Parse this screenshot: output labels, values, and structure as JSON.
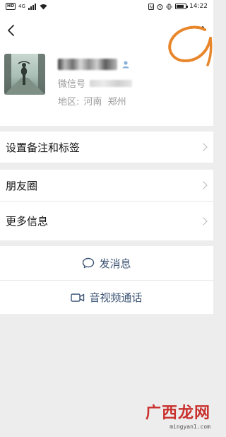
{
  "status_bar": {
    "hd_badge": "HD",
    "network_label": "4G",
    "battery_level": 0.8,
    "time": "14:22"
  },
  "header": {
    "back_icon": "chevron-left-icon",
    "more_icon": "ellipsis-icon"
  },
  "profile": {
    "wechat_id_label": "微信号",
    "region_label": "地区:",
    "region_value": "河南  郑州"
  },
  "menu": {
    "items": [
      {
        "label": "设置备注和标签"
      },
      {
        "label": "朋友圈"
      },
      {
        "label": "更多信息"
      }
    ]
  },
  "actions": {
    "send_message": "发消息",
    "video_call": "音视频通话"
  },
  "watermark": {
    "text": "广西龙网",
    "url": "mingyan1.com"
  },
  "colors": {
    "annotation": "#e8862b",
    "action_text": "#3b5374",
    "background": "#ededed",
    "watermark_red": "#c9302c"
  }
}
